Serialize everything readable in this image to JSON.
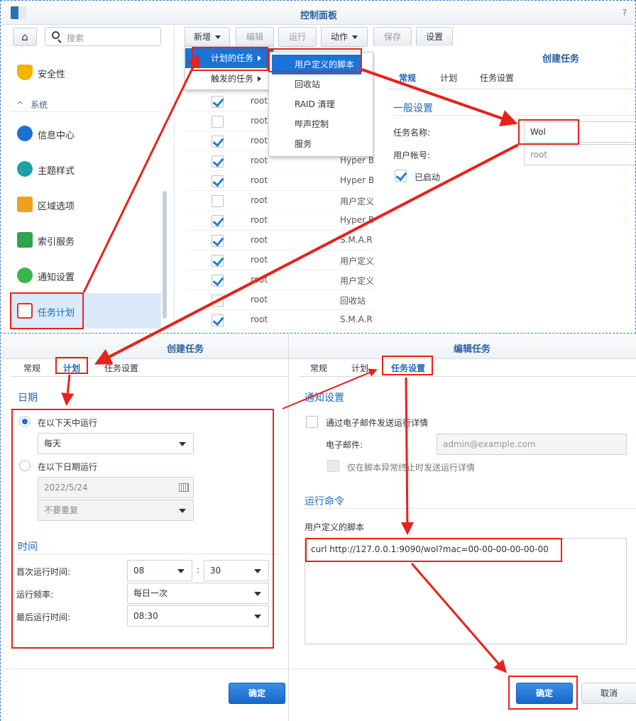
{
  "window": {
    "title": "控制面板",
    "help": "?"
  },
  "sidebar": {
    "search_placeholder": "搜索",
    "section_system": "系统",
    "items": [
      {
        "label": "安全性"
      },
      {
        "label": "信息中心"
      },
      {
        "label": "主题样式"
      },
      {
        "label": "区域选项"
      },
      {
        "label": "索引服务"
      },
      {
        "label": "通知设置"
      },
      {
        "label": "任务计划"
      }
    ]
  },
  "toolbar": {
    "new": "新增",
    "edit": "编辑",
    "run": "运行",
    "action": "动作",
    "save": "保存",
    "settings": "设置"
  },
  "menu": {
    "scheduled": "计划的任务",
    "triggered": "触发的任务",
    "sub": [
      "用户定义的脚本",
      "回收站",
      "RAID 清理",
      "哔声控制",
      "服务"
    ]
  },
  "task_table": {
    "rows": [
      {
        "checked": true,
        "user": "root",
        "type": ""
      },
      {
        "checked": false,
        "user": "root",
        "type": ""
      },
      {
        "checked": true,
        "user": "root",
        "type": ""
      },
      {
        "checked": true,
        "user": "root",
        "type": "Hyper B"
      },
      {
        "checked": true,
        "user": "root",
        "type": "Hyper B"
      },
      {
        "checked": false,
        "user": "root",
        "type": "用户定义"
      },
      {
        "checked": true,
        "user": "root",
        "type": "Hyper B"
      },
      {
        "checked": true,
        "user": "root",
        "type": "S.M.A.R"
      },
      {
        "checked": true,
        "user": "root",
        "type": "用户定义"
      },
      {
        "checked": true,
        "user": "root",
        "type": "用户定义"
      },
      {
        "checked": false,
        "user": "root",
        "type": "回收站"
      },
      {
        "checked": true,
        "user": "root",
        "type": "S.M.A.R"
      }
    ]
  },
  "create_general": {
    "title": "创建任务",
    "tabs": [
      "常规",
      "计划",
      "任务设置"
    ],
    "section": "一般设置",
    "task_name_label": "任务名称:",
    "task_name_value": "Wol",
    "user_label": "用户帐号:",
    "user_value": "root",
    "enabled_label": "已启动"
  },
  "create_schedule": {
    "title": "创建任务",
    "tabs": [
      "常规",
      "计划",
      "任务设置"
    ],
    "date_section": "日期",
    "run_days": "在以下天中运行",
    "days_value": "每天",
    "run_date": "在以下日期运行",
    "date_value": "2022/5/24",
    "repeat_value": "不要重复",
    "time_section": "时间",
    "first_run_label": "首次运行时间:",
    "first_hour": "08",
    "colon": ":",
    "first_minute": "30",
    "freq_label": "运行频率:",
    "freq_value": "每日一次",
    "last_run_label": "最后运行时间:",
    "last_value": "08:30",
    "ok": "确定"
  },
  "edit_task": {
    "title": "编辑任务",
    "tabs": [
      "常规",
      "计划",
      "任务设置"
    ],
    "notify_section": "通知设置",
    "email_details": "通过电子邮件发送运行详情",
    "email_label": "电子邮件:",
    "email_placeholder": "admin@example.com",
    "abnormal_only": "仅在脚本异常终止时发送运行详情",
    "cmd_section": "运行命令",
    "script_label": "用户定义的脚本",
    "script": "curl http://127.0.0.1:9090/wol?mac=00-00-00-00-00-00",
    "ok": "确定",
    "cancel": "取消"
  },
  "colors": {
    "accent": "#1a73d6",
    "annotation": "#e8211a"
  }
}
